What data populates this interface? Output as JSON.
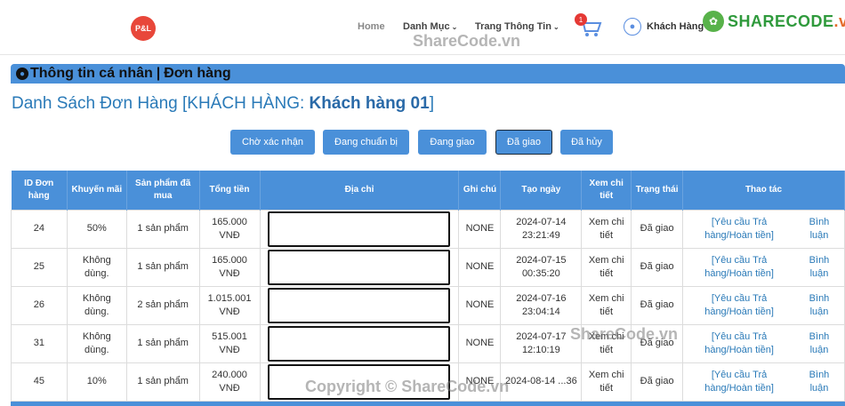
{
  "header": {
    "logo_text": "P&L",
    "nav_home": "Home",
    "nav_category": "Danh Mục",
    "nav_info": "Trang Thông Tin",
    "cart_count": "1",
    "user_name": "Khách Hàng"
  },
  "watermark": {
    "logo_main": "SHARECODE",
    "logo_suffix": ".vn",
    "text_top": "ShareCode.vn",
    "text_mid": "ShareCode.vn",
    "text_bottom": "Copyright © ShareCode.vn"
  },
  "section": {
    "title_left": "Thông tin cá nhân",
    "separator": "|",
    "title_right": "Đơn hàng"
  },
  "page": {
    "title_prefix": "Danh Sách Đơn Hàng [KHÁCH HÀNG: ",
    "customer": "Khách hàng 01",
    "title_suffix": "]"
  },
  "filters": [
    {
      "label": "Chờ xác nhận",
      "active": false
    },
    {
      "label": "Đang chuẩn bị",
      "active": false
    },
    {
      "label": "Đang giao",
      "active": false
    },
    {
      "label": "Đã giao",
      "active": true
    },
    {
      "label": "Đã hủy",
      "active": false
    }
  ],
  "table": {
    "headers": [
      "ID Đơn hàng",
      "Khuyến mãi",
      "Sản phẩm đã mua",
      "Tổng tiền",
      "Địa chỉ",
      "Ghi chú",
      "Tạo ngày",
      "Xem chi tiết",
      "Trạng thái",
      "Thao tác"
    ],
    "rows": [
      {
        "id": "24",
        "promo": "50%",
        "products": "1 sản phẩm",
        "total": "165.000 VNĐ",
        "note": "NONE",
        "date": "2024-07-14 23:21:49",
        "detail": "Xem chi tiết",
        "status": "Đã giao",
        "action1": "[Yêu cầu Trả hàng/Hoàn tiền]",
        "action2": "Bình luận"
      },
      {
        "id": "25",
        "promo": "Không dùng.",
        "products": "1 sản phẩm",
        "total": "165.000 VNĐ",
        "note": "NONE",
        "date": "2024-07-15 00:35:20",
        "detail": "Xem chi tiết",
        "status": "Đã giao",
        "action1": "[Yêu cầu Trả hàng/Hoàn tiền]",
        "action2": "Bình luận"
      },
      {
        "id": "26",
        "promo": "Không dùng.",
        "products": "2 sản phẩm",
        "total": "1.015.001 VNĐ",
        "note": "NONE",
        "date": "2024-07-16 23:04:14",
        "detail": "Xem chi tiết",
        "status": "Đã giao",
        "action1": "[Yêu cầu Trả hàng/Hoàn tiền]",
        "action2": "Bình luận"
      },
      {
        "id": "31",
        "promo": "Không dùng.",
        "products": "1 sản phẩm",
        "total": "515.001 VNĐ",
        "note": "NONE",
        "date": "2024-07-17 12:10:19",
        "detail": "Xem chi tiết",
        "status": "Đã giao",
        "action1": "[Yêu cầu Trả hàng/Hoàn tiền]",
        "action2": "Bình luận"
      },
      {
        "id": "45",
        "promo": "10%",
        "products": "1 sản phẩm",
        "total": "240.000 VNĐ",
        "note": "NONE",
        "date": "2024-08-14 ...36",
        "detail": "Xem chi tiết",
        "status": "Đã giao",
        "action1": "[Yêu cầu Trả hàng/Hoàn tiền]",
        "action2": "Bình luận"
      }
    ]
  },
  "colors": {
    "accent": "#4a90d9",
    "title": "#2a7ab8",
    "badge": "#e53935"
  }
}
